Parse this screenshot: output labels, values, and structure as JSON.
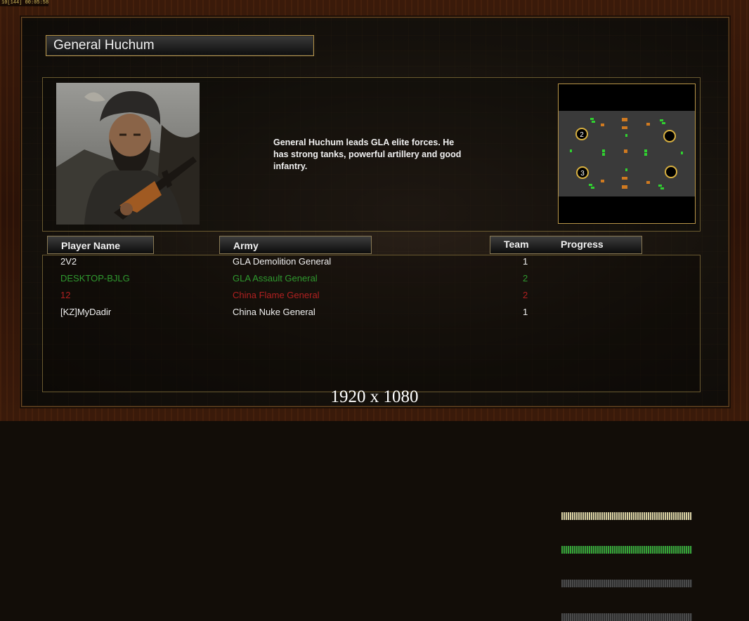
{
  "hud": {
    "text": "10[144] 00:05:58"
  },
  "general": {
    "name": "General Huchum",
    "description": "General Huchum leads GLA elite forces. He\n has strong tanks, powerful artillery and good\n infantry."
  },
  "headers": {
    "player_name": "Player Name",
    "army": "Army",
    "team": "Team",
    "progress": "Progress"
  },
  "players": [
    {
      "name": "2V2",
      "army": "GLA Demolition General",
      "team": "1",
      "progress": 1.0,
      "color": "#f0f0f0",
      "bar_color": "#d8cfa0"
    },
    {
      "name": "DESKTOP-BJLG",
      "army": "GLA Assault General",
      "team": "2",
      "progress": 1.0,
      "color": "#2f9a2f",
      "bar_color": "#35a535"
    },
    {
      "name": "12",
      "army": "China Flame General",
      "team": "2",
      "progress": 1.0,
      "color": "#b02020",
      "bar_color": "#4a4a4a"
    },
    {
      "name": "[KZ]MyDadir",
      "army": "China Nuke General",
      "team": "1",
      "progress": 1.0,
      "color": "#f0f0f0",
      "bar_color": "#4a4a4a"
    }
  ],
  "minimap": {
    "start_markers": [
      "2",
      "3"
    ]
  },
  "resolution": "1920 x 1080"
}
